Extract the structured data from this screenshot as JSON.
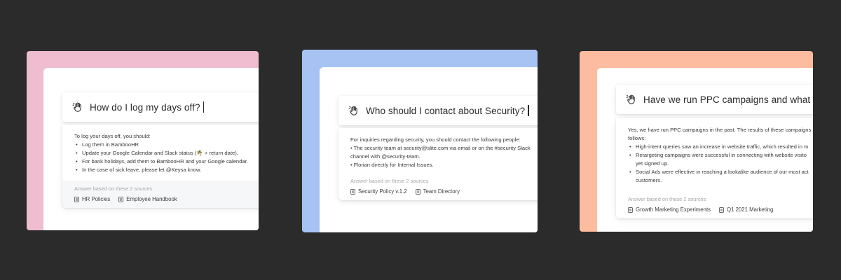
{
  "colors": {
    "background": "#2b2b2b",
    "card_pink": "#efbcd0",
    "card_blue": "#a6c3f3",
    "card_orange": "#fdbb9f"
  },
  "cards": [
    {
      "query": "How do I log my days off?",
      "intro": "To log your days off, you should:",
      "bullets": [
        "Log them in BambooHR",
        "Update your Google Calendar and Slack status (🌴 + return date).",
        "For bank holidays, add them to BambooHR and your Google calendar.",
        "In the case of sick leave, please let @Keysa know."
      ],
      "sources_label": "Answer based on these 2 sources",
      "sources": [
        "HR Policies",
        "Employee Handbook"
      ]
    },
    {
      "query": "Who should I contact about Security?",
      "intro": "For inquiries regarding security, you should contact the following people:",
      "lines": [
        "• The security team at security@slite.com via email or on the #security Slack",
        "channel with @security-team.",
        "• Florian directly for Internal Issues."
      ],
      "sources_label": "Answer based on these 2 sources",
      "sources": [
        "Security Policy v.1.2",
        "Team Directory"
      ]
    },
    {
      "query": "Have we run PPC campaigns and what was the re",
      "intro": "Yes, we have run PPC campaigns in the past. The results of these campaigns",
      "intro2": "follows:",
      "bullets": [
        "High-intent queries saw an increase in website traffic, which resulted in m",
        "Retargeting campaigns were successful in connecting with website visito",
        "yet signed up.",
        "Social Ads were effective in reaching a lookalike audience of our most act",
        "customers."
      ],
      "sources_label": "Answer based on these 2 sources",
      "sources": [
        "Growth Marketing Experiments",
        "Q1 2021 Marketing"
      ]
    }
  ]
}
